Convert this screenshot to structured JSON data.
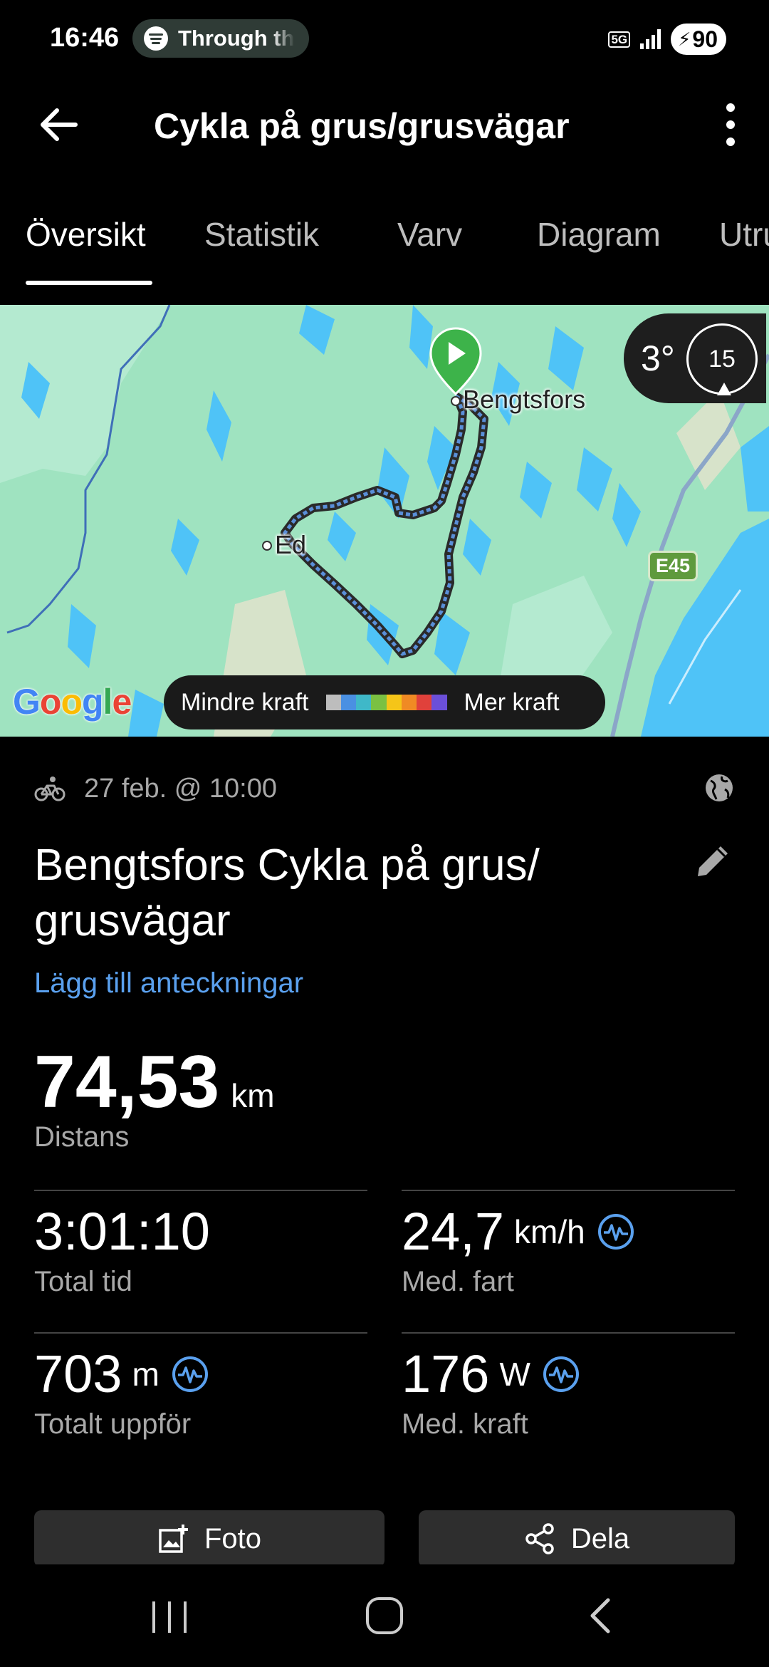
{
  "status_bar": {
    "time": "16:46",
    "media_pill_text": "Through th",
    "network": "5G",
    "battery": "90"
  },
  "header": {
    "title": "Cykla på grus/grusvägar"
  },
  "tabs": [
    {
      "label": "Översikt",
      "active": true
    },
    {
      "label": "Statistik",
      "active": false
    },
    {
      "label": "Varv",
      "active": false
    },
    {
      "label": "Diagram",
      "active": false
    },
    {
      "label": "Utru",
      "active": false
    }
  ],
  "map": {
    "places": {
      "bengtsfors": "Bengtsfors",
      "ed": "Ed"
    },
    "road_sign": "E45",
    "weather": {
      "temperature": "3°",
      "wind": "15"
    },
    "provider": "Google",
    "legend": {
      "less": "Mindre kraft",
      "more": "Mer kraft",
      "colors": [
        "#bdbdbd",
        "#4a90e2",
        "#3fb8c8",
        "#7ac142",
        "#f5c518",
        "#f08a24",
        "#e0413b",
        "#6b4fd8"
      ]
    }
  },
  "activity": {
    "date": "27 feb. @ 10:00",
    "title": "Bengtsfors Cykla på grus/ grusvägar",
    "add_notes": "Lägg till anteckningar",
    "distance": {
      "value": "74,53",
      "unit": "km",
      "label": "Distans"
    },
    "stats": {
      "total_time": {
        "value": "3:01:10",
        "unit": "",
        "label": "Total tid"
      },
      "avg_speed": {
        "value": "24,7",
        "unit": "km/h",
        "label": "Med. fart"
      },
      "elevation": {
        "value": "703",
        "unit": "m",
        "label": "Totalt uppför"
      },
      "avg_power": {
        "value": "176",
        "unit": "W",
        "label": "Med. kraft"
      }
    }
  },
  "buttons": {
    "photo": "Foto",
    "share": "Dela"
  },
  "colors": {
    "accent_blue": "#5aa0ee",
    "map_land": "#9fe3c0",
    "water": "#4fc3f7",
    "start_marker": "#3db34a"
  }
}
